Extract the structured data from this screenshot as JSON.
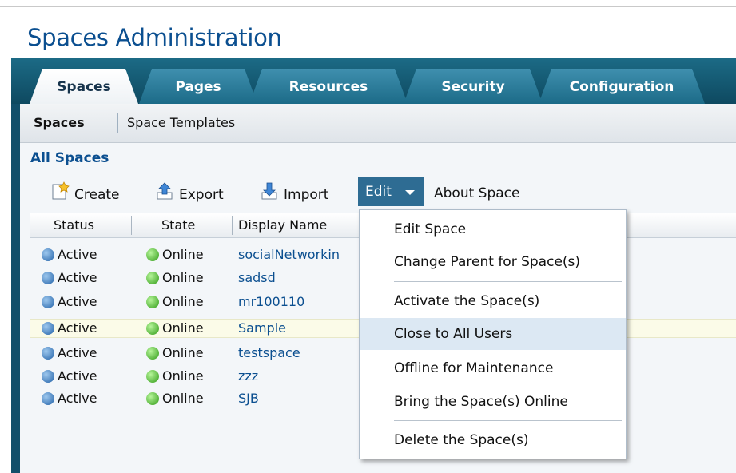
{
  "page": {
    "title": "Spaces Administration"
  },
  "tabs": [
    {
      "label": "Spaces",
      "active": true
    },
    {
      "label": "Pages"
    },
    {
      "label": "Resources"
    },
    {
      "label": "Security"
    },
    {
      "label": "Configuration"
    }
  ],
  "subtabs": [
    {
      "label": "Spaces",
      "active": true
    },
    {
      "label": "Space Templates"
    }
  ],
  "section": {
    "title": "All Spaces"
  },
  "toolbar": {
    "create": "Create",
    "export": "Export",
    "import": "Import",
    "edit": "Edit",
    "about": "About Space"
  },
  "table": {
    "columns": [
      "Status",
      "State",
      "Display Name"
    ],
    "rows": [
      {
        "status": "Active",
        "state": "Online",
        "name": "socialNetworkin"
      },
      {
        "status": "Active",
        "state": "Online",
        "name": "sadsd"
      },
      {
        "status": "Active",
        "state": "Online",
        "name": "mr100110"
      },
      {
        "status": "Active",
        "state": "Online",
        "name": "Sample",
        "highlighted": true
      },
      {
        "status": "Active",
        "state": "Online",
        "name": "testspace"
      },
      {
        "status": "Active",
        "state": "Online",
        "name": "zzz"
      },
      {
        "status": "Active",
        "state": "Online",
        "name": "SJB"
      }
    ]
  },
  "edit_menu": {
    "items": [
      "Edit Space",
      "Change Parent for Space(s)",
      "Activate the Space(s)",
      "Close to All Users",
      "Offline for Maintenance",
      "Bring the Space(s) Online",
      "Delete the Space(s)"
    ],
    "hovered": "Close to All Users"
  },
  "colors": {
    "title": "#0b4f90",
    "tabbar": "#1c6b86",
    "edit_button": "#2e6c93",
    "menu_hover": "#dce8f3"
  }
}
